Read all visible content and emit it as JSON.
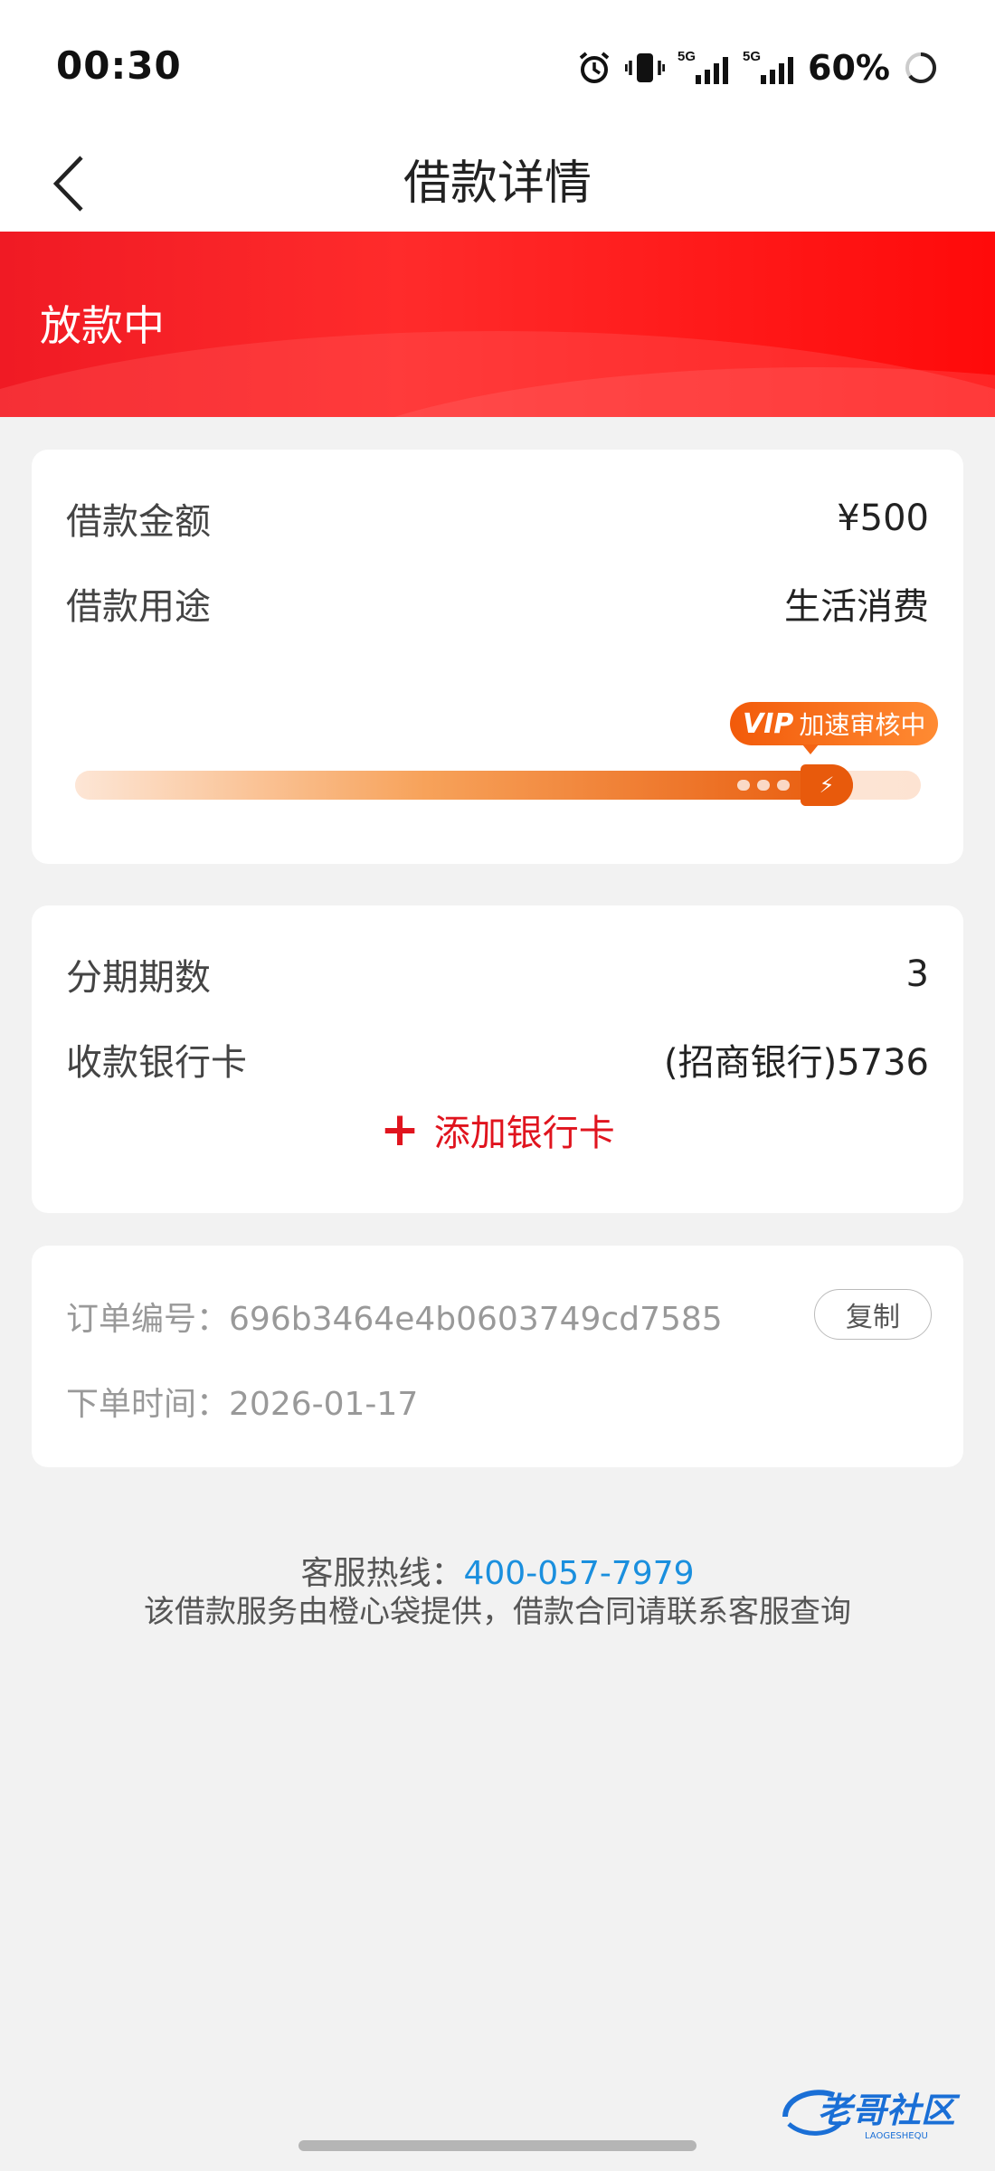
{
  "status_bar": {
    "time": "00:30",
    "battery": "60%",
    "network_label_1": "5G",
    "network_label_2": "5G"
  },
  "nav": {
    "title": "借款详情"
  },
  "banner": {
    "status": "放款中"
  },
  "loan_card": {
    "amount_label": "借款金额",
    "amount_value": "¥500",
    "purpose_label": "借款用途",
    "purpose_value": "生活消费",
    "vip_mark": "VIP",
    "vip_text": "加速审核中",
    "progress_fraction": 0.92
  },
  "bank_card": {
    "installments_label": "分期期数",
    "installments_value": "3",
    "bank_label": "收款银行卡",
    "bank_value": "(招商银行)5736",
    "add_card": "添加银行卡"
  },
  "order_card": {
    "order_no_label": "订单编号：",
    "order_no_value": "696b3464e4b0603749cd7585",
    "copy_label": "复制",
    "order_time_label": "下单时间：",
    "order_time_value": "2026-01-17"
  },
  "footer": {
    "hotline_label": "客服热线：",
    "hotline_number": "400-057-7979",
    "notice": "该借款服务由橙心袋提供，借款合同请联系客服查询"
  },
  "watermark": {
    "text": "老哥社区",
    "sub": "LAOGESHEQU"
  },
  "colors": {
    "accent_red": "#e0141e",
    "banner_red": "#ff1a1a",
    "progress_orange": "#e85a0c",
    "link_blue": "#1a8fde"
  }
}
